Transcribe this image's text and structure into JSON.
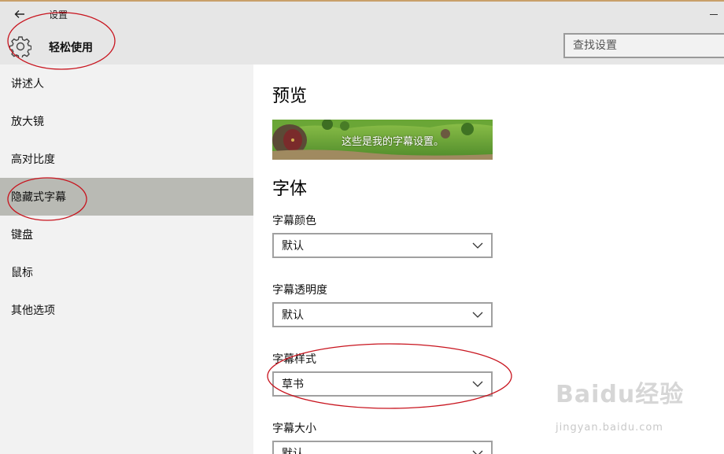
{
  "window": {
    "title": "设置",
    "back_icon": "back-arrow-icon",
    "minimize_icon": "minimize-icon"
  },
  "header": {
    "section_title": "轻松使用",
    "section_icon": "gear-icon",
    "search": {
      "placeholder": "查找设置",
      "value": ""
    }
  },
  "sidebar": {
    "items": [
      {
        "label": "讲述人",
        "selected": false
      },
      {
        "label": "放大镜",
        "selected": false
      },
      {
        "label": "高对比度",
        "selected": false
      },
      {
        "label": "隐藏式字幕",
        "selected": true
      },
      {
        "label": "键盘",
        "selected": false
      },
      {
        "label": "鼠标",
        "selected": false
      },
      {
        "label": "其他选项",
        "selected": false
      }
    ]
  },
  "main": {
    "preview_heading": "预览",
    "preview_caption": "这些是我的字幕设置。",
    "font_heading": "字体",
    "fields": [
      {
        "label": "字幕颜色",
        "value": "默认"
      },
      {
        "label": "字幕透明度",
        "value": "默认"
      },
      {
        "label": "字幕样式",
        "value": "草书"
      },
      {
        "label": "字幕大小",
        "value": "默认"
      }
    ]
  },
  "watermark": {
    "brand": "Baidu经验",
    "url": "jingyan.baidu.com"
  },
  "colors": {
    "header_bg": "#e6e6e6",
    "sidebar_bg": "#f2f2f2",
    "selected_bg": "#b9bab4",
    "annotation_red": "#c8141e"
  }
}
